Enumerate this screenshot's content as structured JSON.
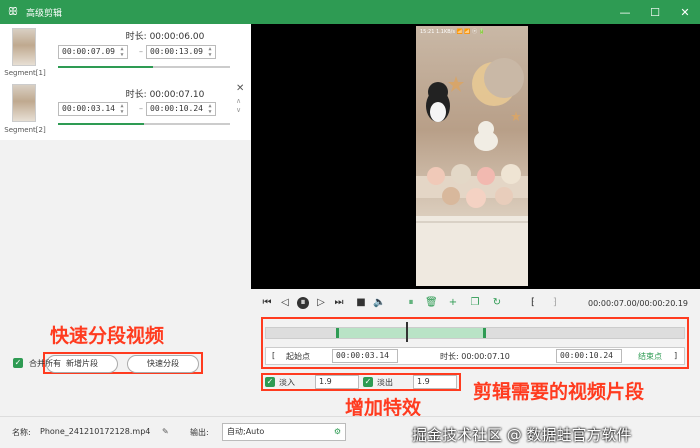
{
  "window": {
    "title": "高级剪辑"
  },
  "segments": [
    {
      "name": "Segment[1]",
      "duration": "时长: 00:00:06.00",
      "start": "00:00:07.09",
      "end": "00:00:13.09",
      "fill": 0.55
    },
    {
      "name": "Segment[2]",
      "duration": "时长: 00:00:07.10",
      "start": "00:00:03.14",
      "end": "00:00:10.24",
      "fill": 0.5
    }
  ],
  "left_actions": {
    "add_segment": "新增片段",
    "quick_split": "快速分段",
    "merge_all": "合并所有"
  },
  "phone_status": "15:21 1.1KB/s 📶 📶 ⓔ 🔋",
  "playback": {
    "time_display": "00:00:07.00/00:00:20.19"
  },
  "range": {
    "start_label": "起始点",
    "start_value": "00:00:03.14",
    "duration_label": "时长: 00:00:07.10",
    "end_value": "00:00:10.24",
    "end_label": "结束点"
  },
  "effects": {
    "fade_in_label": "淡入",
    "fade_in_value": "1.9",
    "fade_out_label": "淡出",
    "fade_out_value": "1.9"
  },
  "bottom": {
    "name_label": "名称:",
    "file_name": "Phone_241210172128.mp4",
    "output_label": "输出:",
    "output_value": "自动;Auto"
  },
  "annotations": {
    "quick_split": "快速分段视频",
    "clip_needed": "剪辑需要的视频片段",
    "add_effects": "增加特效"
  },
  "watermark": "掘金技术社区 @ 数据蛙官方软件",
  "colors": {
    "brand": "#2e9b53",
    "annotation": "#ff3b1f"
  }
}
